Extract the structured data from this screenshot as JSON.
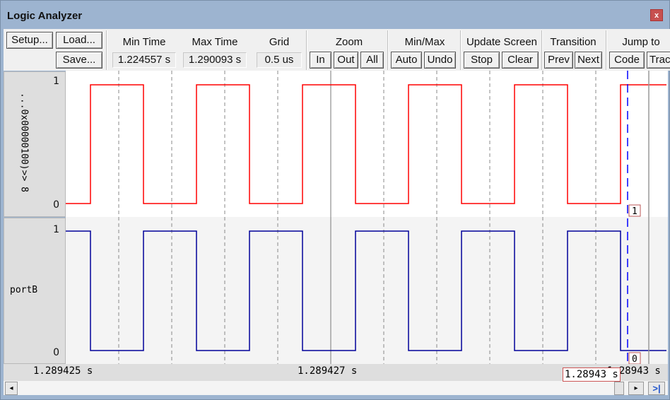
{
  "window": {
    "title": "Logic Analyzer",
    "close_icon": "close-icon"
  },
  "toolbar": {
    "setup": "Setup...",
    "load": "Load...",
    "save": "Save...",
    "min_time_label": "Min Time",
    "min_time": "1.224557 s",
    "max_time_label": "Max Time",
    "max_time": "1.290093 s",
    "grid_label": "Grid",
    "grid": "0.5 us",
    "zoom_label": "Zoom",
    "zoom_in": "In",
    "zoom_out": "Out",
    "zoom_all": "All",
    "minmax_label": "Min/Max",
    "auto": "Auto",
    "undo": "Undo",
    "update_label": "Update Screen",
    "stop": "Stop",
    "clear": "Clear",
    "transition_label": "Transition",
    "prev": "Prev",
    "next": "Next",
    "jump_label": "Jump to",
    "code": "Code",
    "trace": "Trace"
  },
  "signals": [
    {
      "name": "...0x00000100)>> 8",
      "high": "1",
      "low": "0",
      "color": "#ff0000",
      "initial_level": 0,
      "levels": [
        0,
        1,
        0,
        1,
        0,
        1,
        0,
        1,
        0,
        1,
        0,
        1
      ],
      "cursor_value": "1"
    },
    {
      "name": "portB",
      "high": "1",
      "low": "0",
      "color": "#000099",
      "initial_level": 1,
      "levels": [
        1,
        0,
        1,
        0,
        1,
        0,
        1,
        0,
        1,
        0,
        1,
        0
      ],
      "cursor_value": "0"
    }
  ],
  "time_axis": {
    "left": "1.289425 s",
    "center": "1.289427 s",
    "right": "1.28943 s",
    "cursor": "1.28943 s"
  },
  "colors": {
    "cursor": "#0000ff",
    "grid": "#888888"
  }
}
